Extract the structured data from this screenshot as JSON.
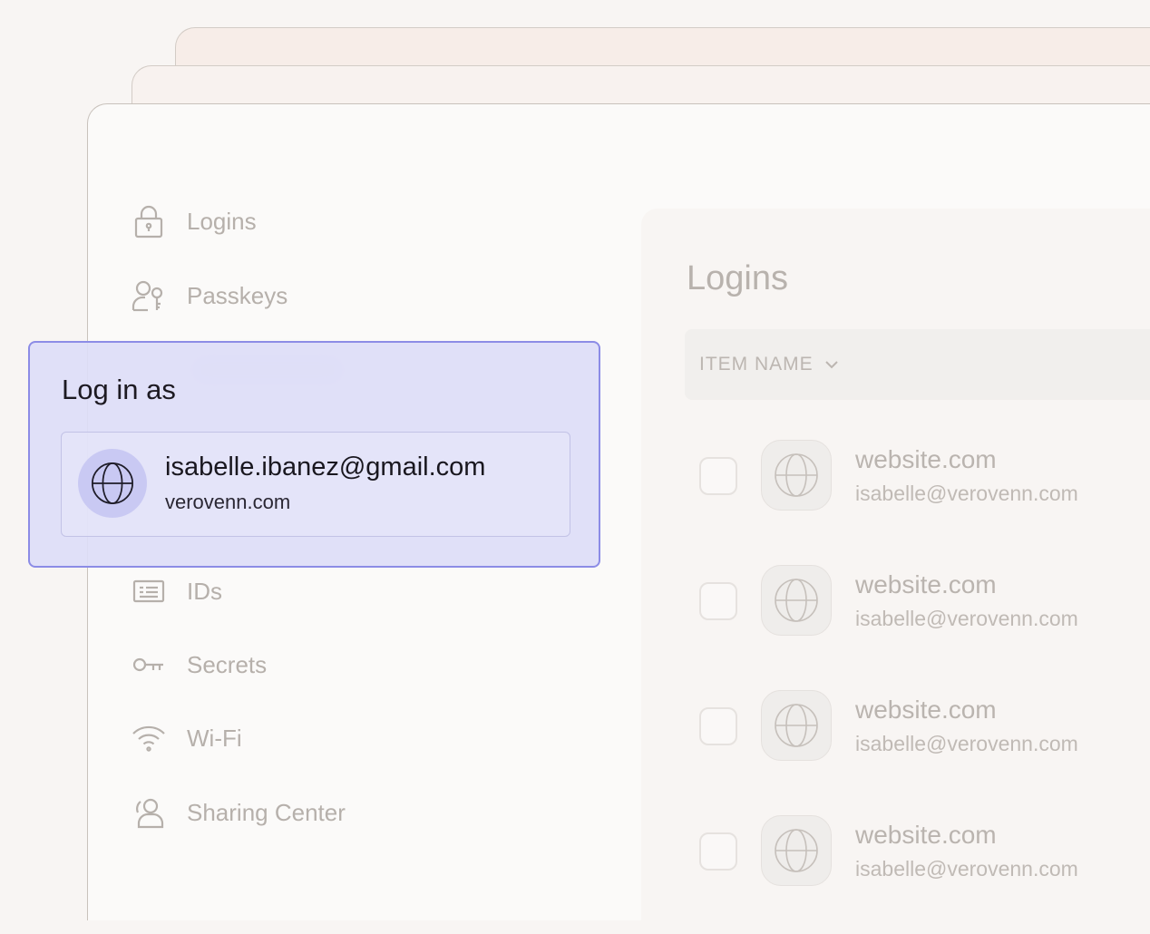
{
  "nav": {
    "items": [
      {
        "label": "Logins",
        "icon": "lock-icon"
      },
      {
        "label": "Passkeys",
        "icon": "passkey-icon"
      },
      {
        "label": "IDs",
        "icon": "id-card-icon"
      },
      {
        "label": "Secrets",
        "icon": "key-icon"
      },
      {
        "label": "Wi-Fi",
        "icon": "wifi-icon"
      },
      {
        "label": "Sharing Center",
        "icon": "sharing-icon"
      }
    ]
  },
  "main": {
    "title": "Logins",
    "column_header": "ITEM NAME",
    "rows": [
      {
        "site": "website.com",
        "email": "isabelle@verovenn.com",
        "icon": "globe-icon"
      },
      {
        "site": "website.com",
        "email": "isabelle@verovenn.com",
        "icon": "globe-icon"
      },
      {
        "site": "website.com",
        "email": "isabelle@verovenn.com",
        "icon": "globe-icon"
      },
      {
        "site": "website.com",
        "email": "isabelle@verovenn.com",
        "icon": "globe-icon"
      }
    ]
  },
  "popup": {
    "title": "Log in as",
    "account": {
      "email": "isabelle.ibanez@gmail.com",
      "site": "verovenn.com",
      "icon": "globe-icon"
    }
  },
  "colors": {
    "popup_background": "#dedef8",
    "popup_border": "#8c8ce6",
    "muted_text": "#b6b0ab",
    "page_background": "#f8f5f3"
  }
}
